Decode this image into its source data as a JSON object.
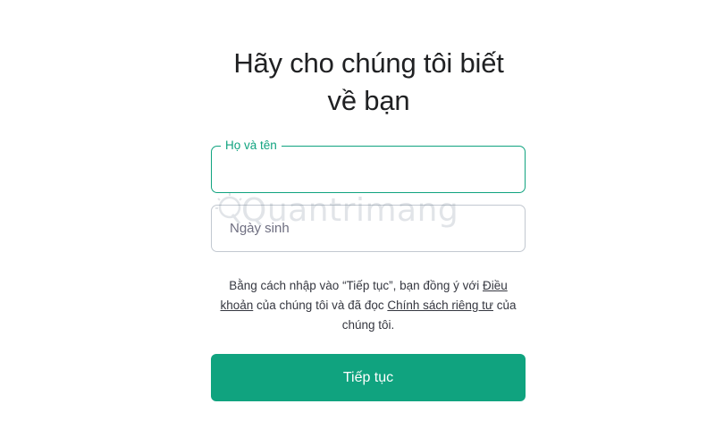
{
  "header": {
    "title_line1": "Hãy cho chúng tôi biết",
    "title_line2": "về bạn"
  },
  "form": {
    "name_field": {
      "label": "Họ và tên",
      "value": ""
    },
    "birthday_field": {
      "placeholder": "Ngày sinh",
      "value": ""
    }
  },
  "consent": {
    "text_before_terms": "Bằng cách nhập vào “Tiếp tục”, bạn đồng ý với ",
    "terms_link": "Điều khoản",
    "text_between": " của chúng tôi và đã đọc ",
    "privacy_link": "Chính sách riêng tư",
    "text_after": " của chúng tôi."
  },
  "actions": {
    "continue_label": "Tiếp tục"
  },
  "watermark": {
    "text": "Quantrimang"
  },
  "colors": {
    "accent": "#10a37f",
    "border": "#c2c8d0",
    "text": "#202123"
  }
}
